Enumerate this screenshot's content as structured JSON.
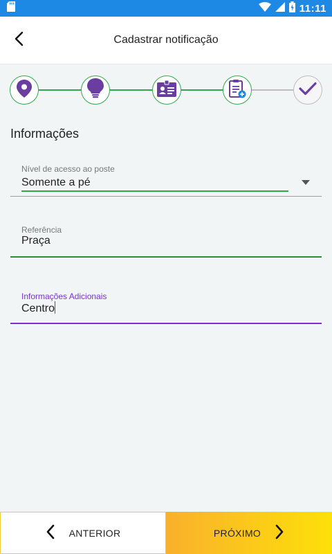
{
  "status_bar": {
    "time": "11:11",
    "icons": [
      "sd-card-icon",
      "wifi-icon",
      "signal-icon",
      "battery-charging-icon"
    ]
  },
  "app_bar": {
    "title": "Cadastrar notificação",
    "back_icon": "back-arrow-icon"
  },
  "stepper": {
    "steps": [
      {
        "icon": "location-pin-icon",
        "state": "done"
      },
      {
        "icon": "light-bulb-icon",
        "state": "done"
      },
      {
        "icon": "id-card-icon",
        "state": "done"
      },
      {
        "icon": "clipboard-add-icon",
        "state": "current"
      },
      {
        "icon": "checkmark-icon",
        "state": "pending"
      }
    ],
    "colors": {
      "done": "#2ea84a",
      "pending": "#bdbdbd",
      "icon": "#6a3ea1"
    }
  },
  "section": {
    "title": "Informações"
  },
  "fields": {
    "access_level": {
      "label": "Nível de acesso ao poste",
      "value": "Somente a pé"
    },
    "reference": {
      "label": "Referência",
      "value": "Praça"
    },
    "additional_info": {
      "label": "Informações Adicionais",
      "value": "Centro"
    }
  },
  "buttons": {
    "previous": "ANTERIOR",
    "next": "PRÓXIMO"
  },
  "colors": {
    "status_bar": "#1e88e5",
    "accent_green": "#2ea84a",
    "accent_purple": "#7b2fd0",
    "next_gradient_start": "#f9b02c",
    "next_gradient_end": "#fde00a"
  }
}
